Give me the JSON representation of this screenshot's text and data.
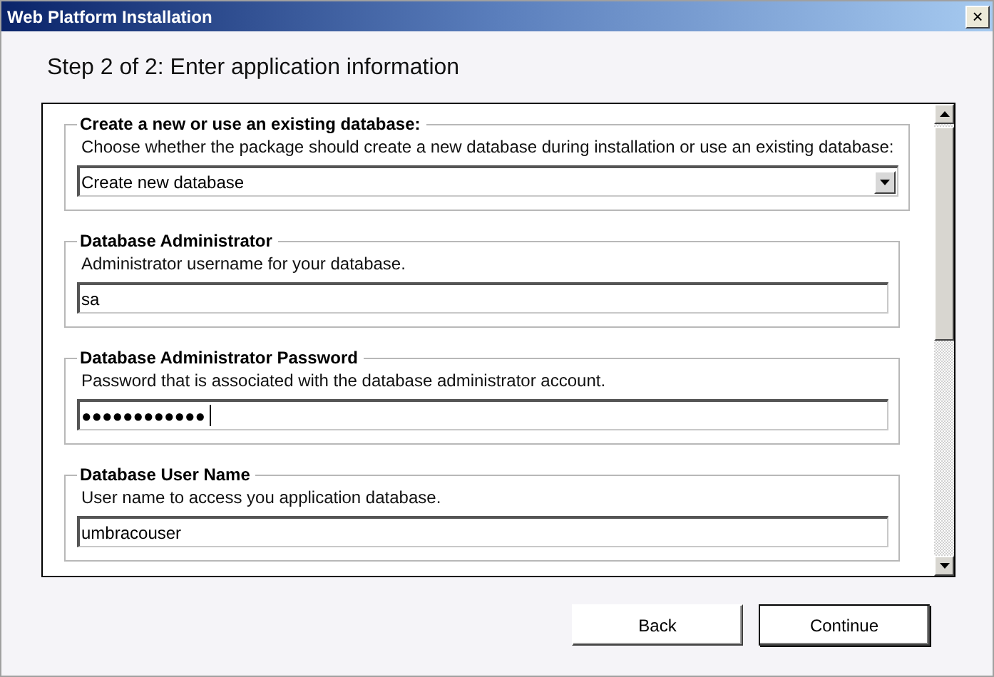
{
  "window": {
    "title": "Web Platform Installation",
    "close": "×"
  },
  "heading": "Step 2 of 2: Enter application information",
  "groups": [
    {
      "legend": "Create a new or use an existing database:",
      "description": "Choose whether the package should create a new database during installation or use an existing database:",
      "field": {
        "kind": "select",
        "value": "Create new database",
        "focused": false
      }
    },
    {
      "legend": "Database Administrator",
      "description": "Administrator username for your database.",
      "field": {
        "kind": "text",
        "value": "sa",
        "focused": false
      }
    },
    {
      "legend": "Database Administrator Password",
      "description": "Password that is associated with the database administrator account.",
      "field": {
        "kind": "password",
        "value": "●●●●●●●●●●●●",
        "focused": true
      }
    },
    {
      "legend": "Database User Name",
      "description": "User name to access you application database.",
      "field": {
        "kind": "text",
        "value": "umbracouser",
        "focused": false
      }
    }
  ],
  "buttons": [
    {
      "label": "Back",
      "default": false
    },
    {
      "label": "Continue",
      "default": true
    }
  ]
}
